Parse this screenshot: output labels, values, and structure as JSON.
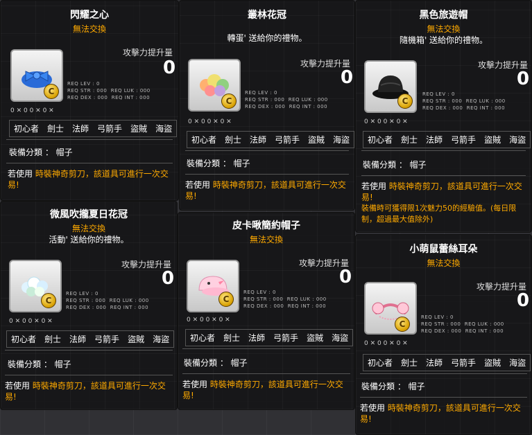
{
  "panels": [
    {
      "title": "閃耀之心",
      "tag": "無法交換",
      "gift_note": "",
      "atk_label": "攻擊力提升量",
      "atk_value": "0",
      "req_text": "REQ LEV : 0\nREQ STR : 000  REQ LUK : 000\nREQ DEX : 000  REQ INT : 000",
      "stat_row": "0 ✕ 0 0 ✕ 0 ✕",
      "jobs": [
        "初心者",
        "劍士",
        "法師",
        "弓箭手",
        "盜賊",
        "海盜"
      ],
      "eq_category": "裝備分類 ： 帽子",
      "usage_prefix": "若使用 ",
      "usage_highlight": "時裝神奇剪刀，該道具可進行一次交易!",
      "extra": "",
      "icon": "blue-ribbon-hat-icon"
    },
    {
      "title": "叢林花冠",
      "tag": "",
      "gift_note": "轉蛋' 送給你的禮物。",
      "atk_label": "攻擊力提升量",
      "atk_value": "0",
      "req_text": "REQ LEV : 0\nREQ STR : 000  REQ LUK : 000\nREQ DEX : 000  REQ INT : 000",
      "stat_row": "0 ✕ 0 0 ✕ 0 ✕",
      "jobs": [
        "初心者",
        "劍士",
        "法師",
        "弓箭手",
        "盜賊",
        "海盜"
      ],
      "eq_category": "裝備分類 ： 帽子",
      "usage_prefix": "若使用 ",
      "usage_highlight": "時裝神奇剪刀，該道具可進行一次交易!",
      "extra": "",
      "icon": "flower-crown-icon"
    },
    {
      "title": "黑色旅遊帽",
      "tag": "無法交換",
      "gift_note": "隨機箱' 送給你的禮物。",
      "atk_label": "攻擊力提升量",
      "atk_value": "0",
      "req_text": "REQ LEV : 0\nREQ STR : 000  REQ LUK : 000\nREQ DEX : 000  REQ INT : 000",
      "stat_row": "0 ✕ 0 0 ✕ 0 ✕",
      "jobs": [
        "初心者",
        "劍士",
        "法師",
        "弓箭手",
        "盜賊",
        "海盜"
      ],
      "eq_category": "裝備分類 ： 帽子",
      "usage_prefix": "若使用 ",
      "usage_highlight": "時裝神奇剪刀，該道具可進行一次交易!",
      "extra": "裝備時可獲得限1次魅力50的經驗值。(每日限制，超過最大值除外)",
      "icon": "black-travel-hat-icon"
    },
    {
      "title": "微風吹攏夏日花冠",
      "tag": "無法交換",
      "gift_note": "活動' 送給你的禮物。",
      "atk_label": "攻擊力提升量",
      "atk_value": "0",
      "req_text": "REQ LEV : 0\nREQ STR : 000  REQ LUK : 000\nREQ DEX : 000  REQ INT : 000",
      "stat_row": "0 ✕ 0 0 ✕ 0 ✕",
      "jobs": [
        "初心者",
        "劍士",
        "法師",
        "弓箭手",
        "盜賊",
        "海盜"
      ],
      "eq_category": "裝備分類 ： 帽子",
      "usage_prefix": "若使用 ",
      "usage_highlight": "時裝神奇剪刀，該道具可進行一次交易!",
      "extra": "",
      "icon": "summer-flower-crown-icon"
    },
    {
      "title": "皮卡啾簡約帽子",
      "tag": "無法交換",
      "gift_note": "",
      "atk_label": "攻擊力提升量",
      "atk_value": "0",
      "req_text": "REQ LEV : 0\nREQ STR : 000  REQ LUK : 000\nREQ DEX : 000  REQ INT : 000",
      "stat_row": "0 ✕ 0 0 ✕ 0 ✕",
      "jobs": [
        "初心者",
        "劍士",
        "法師",
        "弓箭手",
        "盜賊",
        "海盜"
      ],
      "eq_category": "裝備分類 ： 帽子",
      "usage_prefix": "若使用 ",
      "usage_highlight": "時裝神奇剪刀，該道具可進行一次交易!",
      "extra": "",
      "icon": "pink-bird-cap-icon"
    },
    {
      "title": "小萌鼠蕾絲耳朵",
      "tag": "無法交換",
      "gift_note": "",
      "atk_label": "攻擊力提升量",
      "atk_value": "0",
      "req_text": "REQ LEV : 0\nREQ STR : 000  REQ LUK : 000\nREQ DEX : 000  REQ INT : 000",
      "stat_row": "0 ✕ 0 0 ✕ 0 ✕",
      "jobs": [
        "初心者",
        "劍士",
        "法師",
        "弓箭手",
        "盜賊",
        "海盜"
      ],
      "eq_category": "裝備分類 ： 帽子",
      "usage_prefix": "若使用 ",
      "usage_highlight": "時裝神奇剪刀，該道具可進行一次交易!",
      "extra": "",
      "icon": "lace-mouse-ears-icon"
    }
  ],
  "colors": {
    "tag": "#ffaa00",
    "panel_bg": "#161618",
    "text": "#ffffff"
  }
}
